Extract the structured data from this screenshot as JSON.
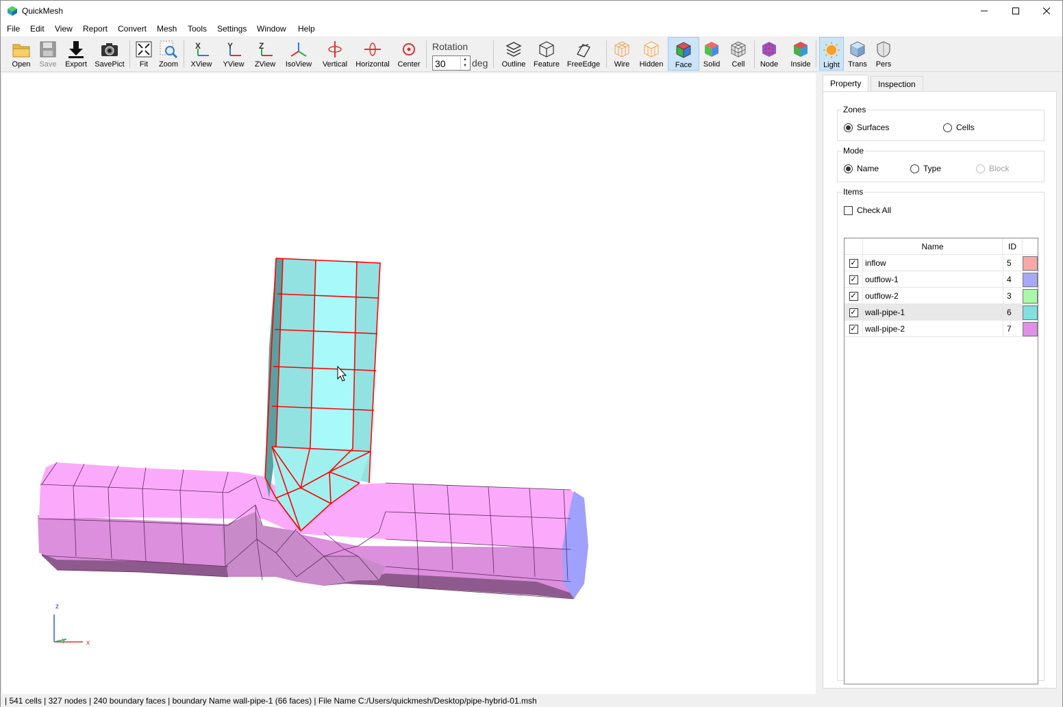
{
  "window": {
    "title": "QuickMesh"
  },
  "menu": [
    "File",
    "Edit",
    "View",
    "Report",
    "Convert",
    "Mesh",
    "Tools",
    "Settings",
    "Window",
    "Help"
  ],
  "toolbar": {
    "open": "Open",
    "save": "Save",
    "export": "Export",
    "savepict": "SavePict",
    "fit": "Fit",
    "zoom": "Zoom",
    "xview": "XView",
    "yview": "YView",
    "zview": "ZView",
    "isoview": "IsoView",
    "vertical": "Vertical",
    "horizontal": "Horizontal",
    "center": "Center",
    "rotation_label": "Rotation",
    "rotation_value": "30",
    "rotation_unit": "deg",
    "outline": "Outline",
    "feature": "Feature",
    "freeedge": "FreeEdge",
    "wire": "Wire",
    "hidden": "Hidden",
    "face": "Face",
    "solid": "Solid",
    "cell": "Cell",
    "node": "Node",
    "inside": "Inside",
    "light": "Light",
    "trans": "Trans",
    "pers": "Pers",
    "active": [
      "face",
      "light"
    ]
  },
  "viewport": {
    "axis_z": "z",
    "axis_y": "y",
    "axis_x": "x",
    "mesh_colors": {
      "wall_pipe_1": "#a8fafa",
      "wall_pipe_2": "#f8a8f8",
      "outflow": "#a0a0ff",
      "highlight": "#ff0000"
    }
  },
  "panel": {
    "tabs": {
      "property": "Property",
      "inspection": "Inspection"
    },
    "zones": {
      "title": "Zones",
      "surfaces": "Surfaces",
      "cells": "Cells",
      "selected": "Surfaces"
    },
    "mode": {
      "title": "Mode",
      "name": "Name",
      "type": "Type",
      "block": "Block",
      "selected": "Name"
    },
    "items": {
      "title": "Items",
      "check_all": "Check All",
      "col_name": "Name",
      "col_id": "ID",
      "rows": [
        {
          "name": "inflow",
          "id": "5",
          "color": "#f8a8a8",
          "checked": true
        },
        {
          "name": "outflow-1",
          "id": "4",
          "color": "#a8a8f8",
          "checked": true
        },
        {
          "name": "outflow-2",
          "id": "3",
          "color": "#a8f8a8",
          "checked": true
        },
        {
          "name": "wall-pipe-1",
          "id": "6",
          "color": "#80e0e0",
          "checked": true
        },
        {
          "name": "wall-pipe-2",
          "id": "7",
          "color": "#e090e8",
          "checked": true
        }
      ],
      "selected_row": "wall-pipe-1"
    }
  },
  "status": "| 541 cells | 327 nodes | 240 boundary faces |  boundary Name wall-pipe-1 (66 faces) | File Name C:/Users/quickmesh/Desktop/pipe-hybrid-01.msh"
}
